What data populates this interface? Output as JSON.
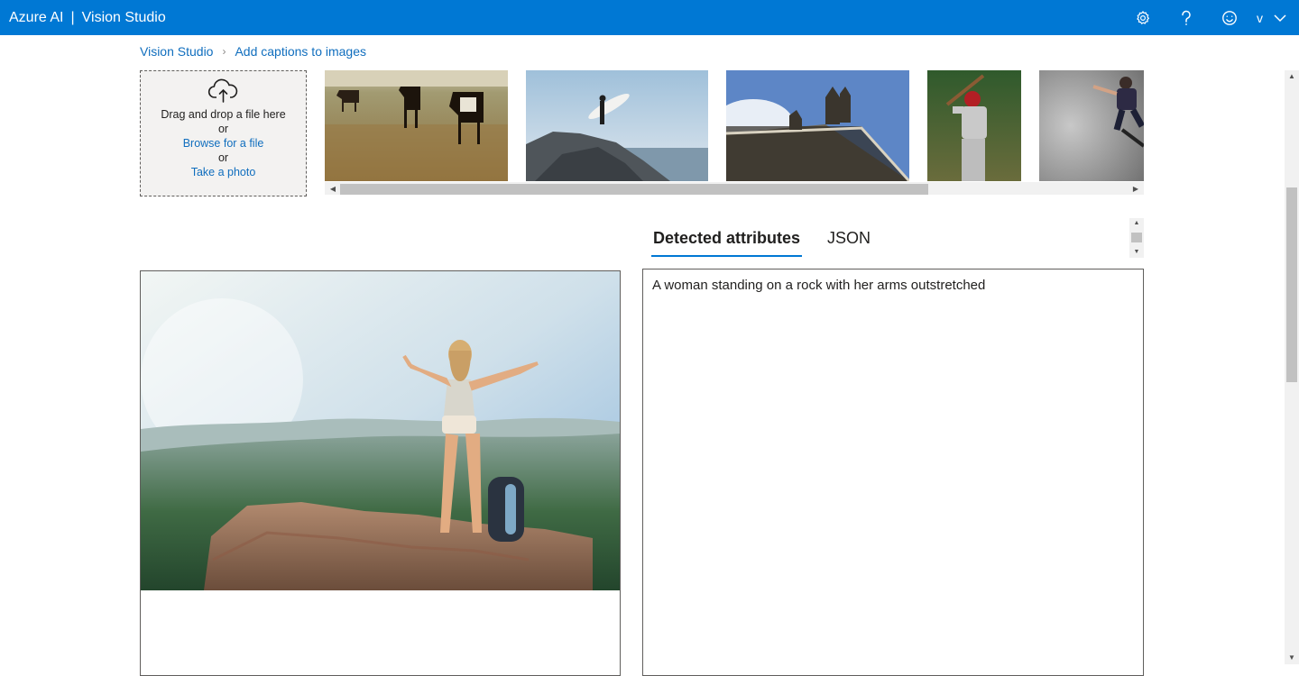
{
  "header": {
    "brand_product": "Azure AI",
    "brand_separator": "|",
    "brand_app": "Vision Studio",
    "user_initial": "v",
    "accent_color": "#0078d4"
  },
  "breadcrumb": {
    "root": "Vision Studio",
    "current": "Add captions to images"
  },
  "upload": {
    "drag_text": "Drag and drop a file here",
    "or_1": "or",
    "browse_link": "Browse for a file",
    "or_2": "or",
    "photo_link": "Take a photo",
    "icon": "cloud-upload-icon"
  },
  "samples": [
    {
      "subject": "horses-in-field"
    },
    {
      "subject": "surfer-on-rock"
    },
    {
      "subject": "building-statues"
    },
    {
      "subject": "baseball-batter"
    },
    {
      "subject": "skateboarder"
    }
  ],
  "tabs": [
    {
      "label": "Detected attributes",
      "active": true
    },
    {
      "label": "JSON",
      "active": false
    }
  ],
  "result": {
    "caption": "A woman standing on a rock with her arms outstretched"
  }
}
